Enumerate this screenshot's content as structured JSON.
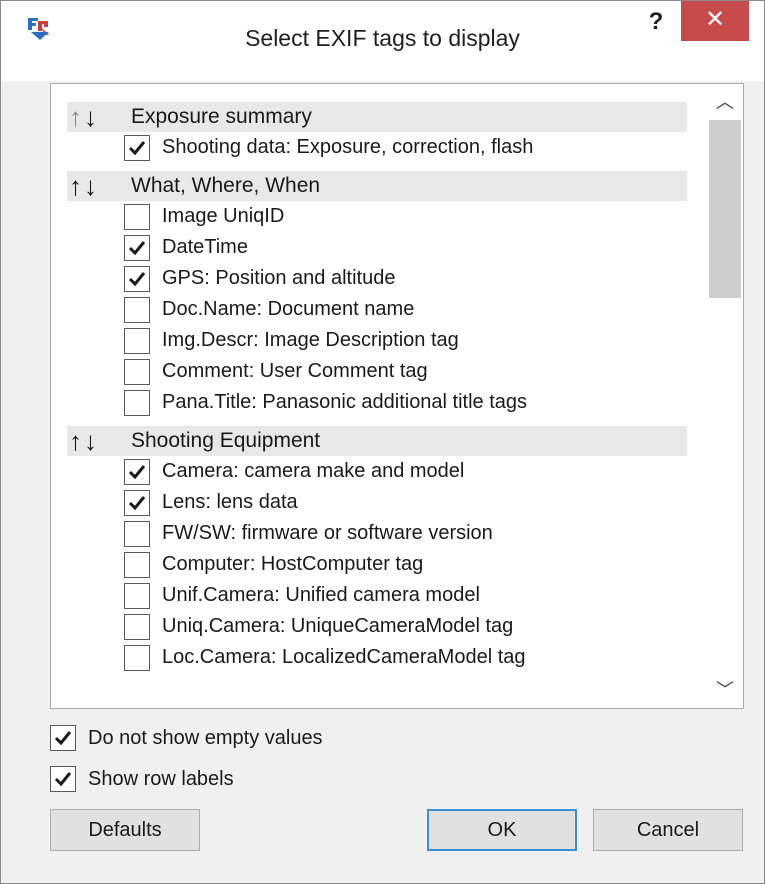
{
  "window": {
    "title": "Select EXIF tags to display",
    "help_glyph": "?",
    "close_glyph": "✕",
    "app_icon": "fr-logo-icon"
  },
  "groups": [
    {
      "title": "Exposure summary",
      "up_arrow": "↑",
      "down_arrow": "↓",
      "up_disabled": true,
      "items": [
        {
          "label": "Shooting data: Exposure, correction, flash",
          "checked": true
        }
      ]
    },
    {
      "title": "What, Where, When",
      "up_arrow": "↑",
      "down_arrow": "↓",
      "up_disabled": false,
      "items": [
        {
          "label": "Image UniqID",
          "checked": false
        },
        {
          "label": "DateTime",
          "checked": true
        },
        {
          "label": "GPS: Position and altitude",
          "checked": true
        },
        {
          "label": "Doc.Name: Document name",
          "checked": false
        },
        {
          "label": "Img.Descr: Image Description tag",
          "checked": false
        },
        {
          "label": "Comment: User Comment tag",
          "checked": false
        },
        {
          "label": "Pana.Title: Panasonic additional title tags",
          "checked": false
        }
      ]
    },
    {
      "title": "Shooting Equipment",
      "up_arrow": "↑",
      "down_arrow": "↓",
      "up_disabled": false,
      "items": [
        {
          "label": "Camera: camera make and model",
          "checked": true
        },
        {
          "label": "Lens: lens data",
          "checked": true
        },
        {
          "label": "FW/SW: firmware or software version",
          "checked": false
        },
        {
          "label": "Computer: HostComputer tag",
          "checked": false
        },
        {
          "label": "Unif.Camera: Unified camera model",
          "checked": false
        },
        {
          "label": "Uniq.Camera: UniqueCameraModel tag",
          "checked": false
        },
        {
          "label": "Loc.Camera: LocalizedCameraModel tag",
          "checked": false
        }
      ]
    }
  ],
  "options": {
    "hide_empty": {
      "label": "Do not show empty values",
      "checked": true
    },
    "row_labels": {
      "label": "Show row labels",
      "checked": true
    }
  },
  "buttons": {
    "defaults": "Defaults",
    "ok": "OK",
    "cancel": "Cancel"
  },
  "scrollbar": {
    "up_glyph": "︿",
    "down_glyph": "﹀"
  },
  "colors": {
    "close_button": "#c74b4b",
    "default_button_border": "#3c8fd6",
    "group_header_bg": "#e8e8e8"
  }
}
